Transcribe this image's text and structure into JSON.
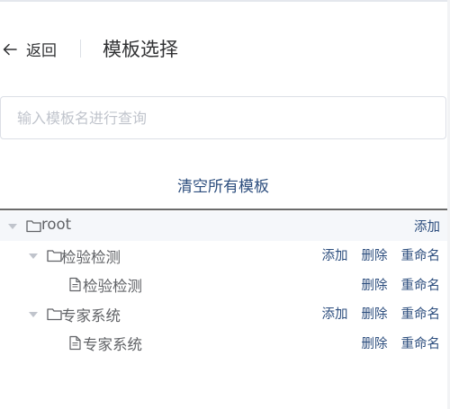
{
  "header": {
    "back_label": "返回",
    "title": "模板选择"
  },
  "search": {
    "placeholder": "输入模板名进行查询",
    "value": ""
  },
  "clear_all_label": "清空所有模板",
  "tree": {
    "root": {
      "label": "root",
      "add_label": "添加"
    },
    "items": [
      {
        "label": "检验检测",
        "type": "folder",
        "add_label": "添加",
        "delete_label": "删除",
        "rename_label": "重命名"
      },
      {
        "label": "检验检测",
        "type": "file",
        "delete_label": "删除",
        "rename_label": "重命名"
      },
      {
        "label": "专家系统",
        "type": "folder",
        "add_label": "添加",
        "delete_label": "删除",
        "rename_label": "重命名"
      },
      {
        "label": "专家系统",
        "type": "file",
        "delete_label": "删除",
        "rename_label": "重命名"
      }
    ]
  },
  "colors": {
    "link": "#2d4e7e",
    "text": "#303133",
    "muted_text": "#606266",
    "placeholder": "#c0c4cc",
    "root_row_bg": "#f5f7fa"
  }
}
